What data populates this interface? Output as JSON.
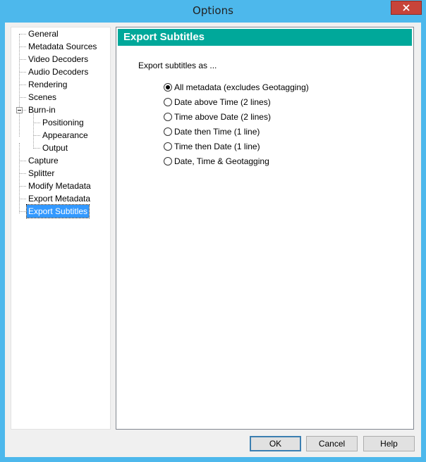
{
  "window": {
    "title": "Options"
  },
  "tree": {
    "items": [
      {
        "label": "General"
      },
      {
        "label": "Metadata Sources"
      },
      {
        "label": "Video Decoders"
      },
      {
        "label": "Audio Decoders"
      },
      {
        "label": "Rendering"
      },
      {
        "label": "Scenes"
      },
      {
        "label": "Burn-in",
        "expanded": true,
        "children": [
          {
            "label": "Positioning"
          },
          {
            "label": "Appearance"
          },
          {
            "label": "Output"
          }
        ]
      },
      {
        "label": "Capture"
      },
      {
        "label": "Splitter"
      },
      {
        "label": "Modify Metadata"
      },
      {
        "label": "Export Metadata"
      },
      {
        "label": "Export Subtitles",
        "selected": true
      }
    ]
  },
  "panel": {
    "header": "Export Subtitles",
    "section_label": "Export subtitles as ...",
    "options": [
      {
        "label": "All metadata (excludes Geotagging)",
        "checked": true
      },
      {
        "label": "Date above Time (2 lines)",
        "checked": false
      },
      {
        "label": "Time above Date (2 lines)",
        "checked": false
      },
      {
        "label": "Date then Time (1 line)",
        "checked": false
      },
      {
        "label": "Time then Date (1 line)",
        "checked": false
      },
      {
        "label": "Date, Time & Geotagging",
        "checked": false
      }
    ]
  },
  "buttons": {
    "ok": "OK",
    "cancel": "Cancel",
    "help": "Help"
  },
  "colors": {
    "header_bg": "#00a89a",
    "selection": "#3399ff",
    "frame": "#4db8ec",
    "close": "#c7443a"
  }
}
